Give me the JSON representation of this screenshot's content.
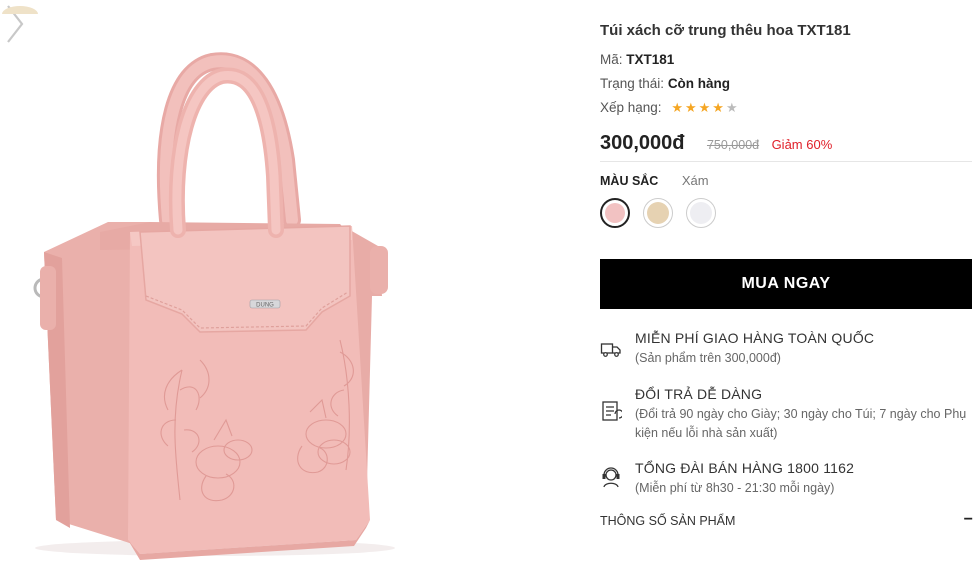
{
  "product": {
    "title": "Túi xách cỡ trung thêu hoa TXT181",
    "code_label": "Mã:",
    "code_value": "TXT181",
    "status_label": "Trạng thái:",
    "status_value": "Còn hàng",
    "rating_label": "Xếp hạng:",
    "rating": 4,
    "rating_max": 5,
    "price": "300,000đ",
    "old_price": "750,000đ",
    "discount": "Giảm 60%",
    "bag_logo": "DUNG"
  },
  "colors": {
    "label": "MÀU SẮC",
    "selected_name": "Xám",
    "swatches": [
      {
        "name": "pink",
        "color": "#f2c2c2",
        "selected": true
      },
      {
        "name": "beige",
        "color": "#e6d2b2",
        "selected": false
      },
      {
        "name": "white",
        "color": "#eeeef2",
        "selected": false
      }
    ]
  },
  "buy_button": "MUA NGAY",
  "benefits": [
    {
      "icon": "delivery-truck-icon",
      "title": "MIỄN PHÍ GIAO HÀNG TOÀN QUỐC",
      "desc": "(Sản phẩm trên 300,000đ)"
    },
    {
      "icon": "return-document-icon",
      "title": "ĐỔI TRẢ DỄ DÀNG",
      "desc": "(Đổi trả 90 ngày cho Giày; 30 ngày cho Túi; 7 ngày cho Phụ kiện nếu lỗi nhà sản xuất)"
    },
    {
      "icon": "hotline-operator-icon",
      "title": "TỔNG ĐÀI BÁN HÀNG 1800 1162",
      "desc": "(Miễn phí từ 8h30 - 21:30 mỗi ngày)"
    }
  ],
  "specs": {
    "label": "THÔNG SỐ SẢN PHẨM",
    "toggle": "−"
  },
  "theme": {
    "price_red": "#e0202a",
    "star": "#f5a623",
    "bag_pink": "#f0b9b5",
    "button_black": "#000000"
  }
}
